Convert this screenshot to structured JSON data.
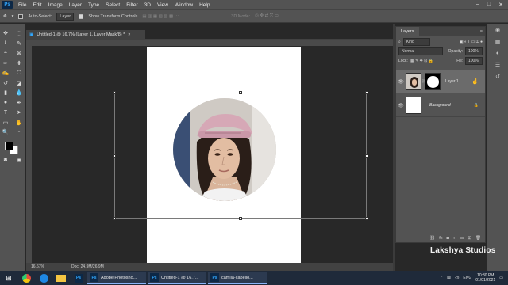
{
  "app": {
    "logo": "Ps"
  },
  "menu": [
    "File",
    "Edit",
    "Image",
    "Layer",
    "Type",
    "Select",
    "Filter",
    "3D",
    "View",
    "Window",
    "Help"
  ],
  "window_controls": {
    "minimize": "–",
    "maximize": "□",
    "close": "✕"
  },
  "options_bar": {
    "auto_select_label": "Auto-Select:",
    "auto_select_value": "Layer",
    "transform_label": "Show Transform Controls",
    "mode_3d_label": "3D Mode:"
  },
  "document": {
    "tab_title": "Untitled-1 @ 16.7% (Layer 1, Layer Mask/8) *",
    "zoom": "16.67%",
    "doc_size": "Doc: 24.9M/26.9M"
  },
  "layers_panel": {
    "tab_label": "Layers",
    "filter_kind": "Kind",
    "blend_mode": "Normal",
    "opacity_label": "Opacity:",
    "opacity_value": "100%",
    "lock_label": "Lock:",
    "fill_label": "Fill:",
    "fill_value": "100%",
    "layers": [
      {
        "name": "Layer 1",
        "visible": true,
        "has_mask": true
      },
      {
        "name": "Background",
        "visible": true,
        "locked": true
      }
    ],
    "footer_icons": [
      "link-icon",
      "fx-icon",
      "mask-icon",
      "adjustment-icon",
      "group-icon",
      "new-layer-icon",
      "trash-icon"
    ]
  },
  "watermark": "Lakshya Studios",
  "taskbar": {
    "apps": [
      {
        "label": "Adobe Photosho..."
      },
      {
        "label": "Untitled-1 @ 16.7..."
      },
      {
        "label": "camila-cabello..."
      }
    ],
    "lang": "ENG",
    "time": "10:30 PM",
    "date": "01/01/2021"
  },
  "colors": {
    "ui_bg": "#535353",
    "canvas_bg": "#282828",
    "accent": "#31a8ff"
  }
}
